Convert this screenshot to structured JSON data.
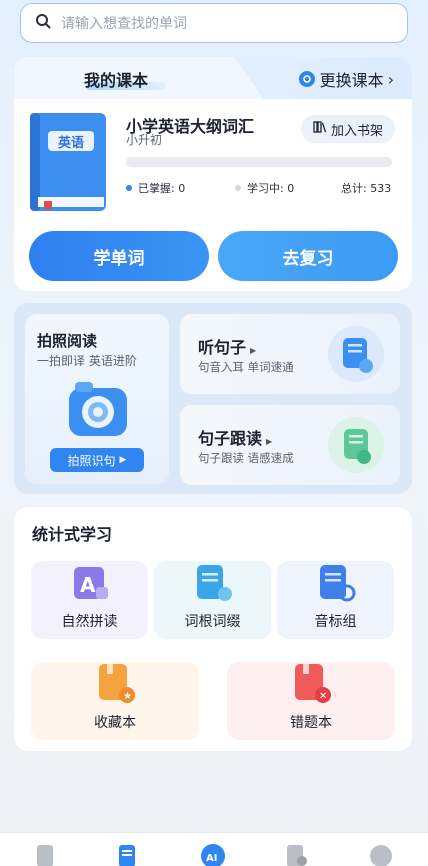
{
  "search": {
    "placeholder": "请输入想查找的单词"
  },
  "textbook": {
    "section_title": "我的课本",
    "change_label": "更换课本",
    "cover_label": "英语",
    "book_name": "小学英语大纲词汇",
    "book_level": "小升初",
    "add_shelf_label": "加入书架",
    "progress_mastered_fraction": 0,
    "mastered": "已掌握: 0",
    "learning": "学习中: 0",
    "total": "总计: 533",
    "learn_button": "学单词",
    "review_button": "去复习"
  },
  "features": {
    "photo_read": {
      "title": "拍照阅读",
      "subtitle": "一拍即译 英语进阶",
      "button": "拍照识句"
    },
    "listen": {
      "title": "听句子",
      "subtitle": "句音入耳 单词速通"
    },
    "follow": {
      "title": "句子跟读",
      "subtitle": "句子跟读 语感速成"
    }
  },
  "stats_learning": {
    "title": "统计式学习",
    "tiles": [
      {
        "label": "自然拼读",
        "icon": "phonics-icon"
      },
      {
        "label": "词根词缀",
        "icon": "word-root-icon"
      },
      {
        "label": "音标组",
        "icon": "phonetic-icon"
      },
      {
        "label": "收藏本",
        "icon": "favorites-book-icon"
      },
      {
        "label": "错题本",
        "icon": "mistakes-book-icon"
      }
    ]
  },
  "colors": {
    "primary": "#2f86f0",
    "accent_orange": "#f4a340",
    "accent_red": "#ef5b5b"
  }
}
